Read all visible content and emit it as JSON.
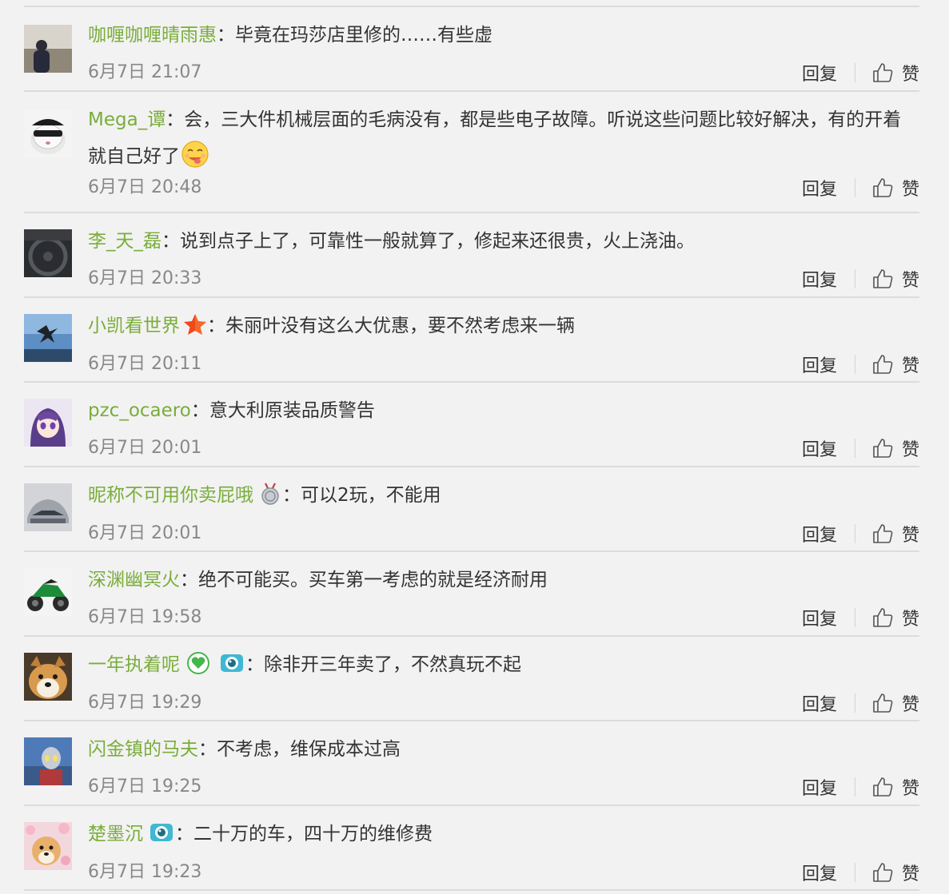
{
  "labels": {
    "reply": "回复",
    "like": "赞",
    "colon": "："
  },
  "comments": [
    {
      "username": "咖喱咖喱晴雨惠",
      "text": "毕竟在玛莎店里修的……有些虚",
      "time": "6月7日 21:07",
      "avatar": "avatar-person-city",
      "badges": []
    },
    {
      "username": "Mega_谭",
      "text": "会，三大件机械层面的毛病没有，都是些电子故障。听说这些问题比较好解决，有的开着就自己好了",
      "time": "6月7日 20:48",
      "avatar": "avatar-cat-sunglasses",
      "badges": [],
      "emoji": "yummy-face-icon"
    },
    {
      "username": "李_天_磊",
      "text": "说到点子上了，可靠性一般就算了，修起来还很贵，火上浇油。",
      "time": "6月7日 20:33",
      "avatar": "avatar-steering-wheel",
      "badges": []
    },
    {
      "username": "小凯看世界",
      "text": "朱丽叶没有这么大优惠，要不然考虑来一辆",
      "time": "6月7日 20:11",
      "avatar": "avatar-jumping-person",
      "badges": [
        "star-badge-icon"
      ]
    },
    {
      "username": "pzc_ocaero",
      "text": "意大利原装品质警告",
      "time": "6月7日 20:01",
      "avatar": "avatar-anime-girl",
      "badges": []
    },
    {
      "username": "昵称不可用你卖屁哦",
      "text": "可以2玩，不能用",
      "time": "6月7日 20:01",
      "avatar": "avatar-car-front",
      "badges": [
        "medal-badge-icon"
      ]
    },
    {
      "username": "深渊幽冥火",
      "text": "绝不可能买。买车第一考虑的就是经济耐用",
      "time": "6月7日 19:58",
      "avatar": "avatar-motorcycle",
      "badges": []
    },
    {
      "username": "一年执着呢",
      "text": "除非开三年卖了，不然真玩不起",
      "time": "6月7日 19:29",
      "avatar": "avatar-shiba-dog",
      "badges": [
        "heart-badge-icon",
        "camera-badge-icon"
      ]
    },
    {
      "username": "闪金镇的马夫",
      "text": "不考虑，维保成本过高",
      "time": "6月7日 19:25",
      "avatar": "avatar-ultraman",
      "badges": []
    },
    {
      "username": "楚墨沉",
      "text": "二十万的车，四十万的维修费",
      "time": "6月7日 19:23",
      "avatar": "avatar-dog-flowers",
      "badges": [
        "camera-badge-icon"
      ]
    }
  ]
}
